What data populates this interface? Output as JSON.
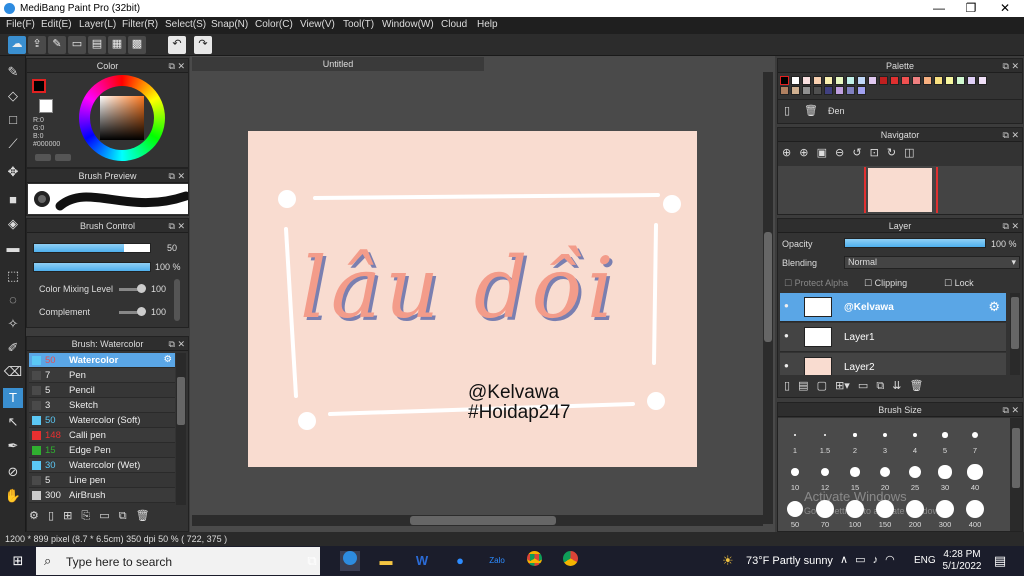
{
  "window": {
    "title": "MediBang Paint Pro (32bit)",
    "minimize": "—",
    "maximize": "❐",
    "close": "✕"
  },
  "menu": [
    "File(F)",
    "Edit(E)",
    "Layer(L)",
    "Filter(R)",
    "Select(S)",
    "Snap(N)",
    "Color(C)",
    "View(V)",
    "Tool(T)",
    "Window(W)",
    "Cloud",
    "Help"
  ],
  "color_panel": {
    "title": "Color",
    "r": "R:0",
    "g": "G:0",
    "b": "B:0",
    "hex": "#000000",
    "primary": "#000000"
  },
  "brush_preview": {
    "title": "Brush Preview"
  },
  "brush_control": {
    "title": "Brush Control",
    "size_value": "50",
    "opacity_value": "100 %",
    "mixing_label": "Color Mixing Level",
    "mixing_value": "100",
    "complement_label": "Complement",
    "complement_value": "100"
  },
  "brush_list": {
    "title": "Brush: Watercolor",
    "items": [
      {
        "num": "50",
        "name": "Watercolor",
        "color": "#5bc8f5",
        "selected": true
      },
      {
        "num": "7",
        "name": "Pen",
        "color": "#4a4a4a"
      },
      {
        "num": "5",
        "name": "Pencil",
        "color": "#4a4a4a"
      },
      {
        "num": "3",
        "name": "Sketch",
        "color": "#4a4a4a"
      },
      {
        "num": "50",
        "name": "Watercolor (Soft)",
        "color": "#5bc8f5"
      },
      {
        "num": "148",
        "name": "Calli pen",
        "color": "#e83030"
      },
      {
        "num": "15",
        "name": "Edge Pen",
        "color": "#30b030"
      },
      {
        "num": "30",
        "name": "Watercolor (Wet)",
        "color": "#5bc8f5"
      },
      {
        "num": "5",
        "name": "Line pen",
        "color": "#4a4a4a"
      },
      {
        "num": "300",
        "name": "AirBrush",
        "color": "#cccccc"
      }
    ]
  },
  "document": {
    "tab": "Untitled",
    "main_text": "lâu dồi",
    "handle": "@Kelvawa",
    "tag": "#Hoidap247"
  },
  "palette": {
    "title": "Palette",
    "swatches_row1": [
      "#000000",
      "#ffffff",
      "#f9e0e0",
      "#f9d0b0",
      "#f9f0b0",
      "#e8f9c0",
      "#c0f0e8",
      "#c0d8f9",
      "#e0c8f0",
      "#c02020",
      "#e03030",
      "#f05050",
      "#f08080",
      "#f8b080",
      "#f8e080",
      "#f8f8a0",
      "#d0f8d0",
      "#e0d0f8",
      "#f0e0f8"
    ],
    "swatches_row2": [
      "#b08060",
      "#d0b090",
      "#909090",
      "#505050",
      "#404080",
      "#c0a0e0",
      "#8080c0",
      "#a0a0f0"
    ],
    "selected_name": "Đen"
  },
  "navigator": {
    "title": "Navigator"
  },
  "layer_panel": {
    "title": "Layer",
    "opacity_label": "Opacity",
    "opacity_value": "100 %",
    "opacity_fraction": 1.0,
    "blending_label": "Blending",
    "blending_value": "Normal",
    "protect_alpha": "Protect Alpha",
    "clipping": "Clipping",
    "lock": "Lock",
    "layers": [
      {
        "name": "@Kelvawa",
        "selected": true
      },
      {
        "name": "Layer1",
        "selected": false
      },
      {
        "name": "Layer2",
        "selected": false
      }
    ]
  },
  "brush_size": {
    "title": "Brush Size",
    "sizes": [
      "1",
      "1.5",
      "2",
      "3",
      "4",
      "5",
      "7",
      "10",
      "12",
      "15",
      "20",
      "25",
      "30",
      "40",
      "50",
      "70",
      "100",
      "150",
      "200",
      "300",
      "400"
    ]
  },
  "watermark": {
    "line1": "Activate Windows",
    "line2": "Go to Settings to activate Windows."
  },
  "status": "1200 * 899 pixel   (8.7 * 6.5cm)   350 dpi   50 %   ( 722, 375 )",
  "taskbar": {
    "search_placeholder": "Type here to search",
    "weather": "73°F  Partly sunny",
    "lang": "ENG",
    "time": "4:28 PM",
    "date": "5/1/2022"
  }
}
